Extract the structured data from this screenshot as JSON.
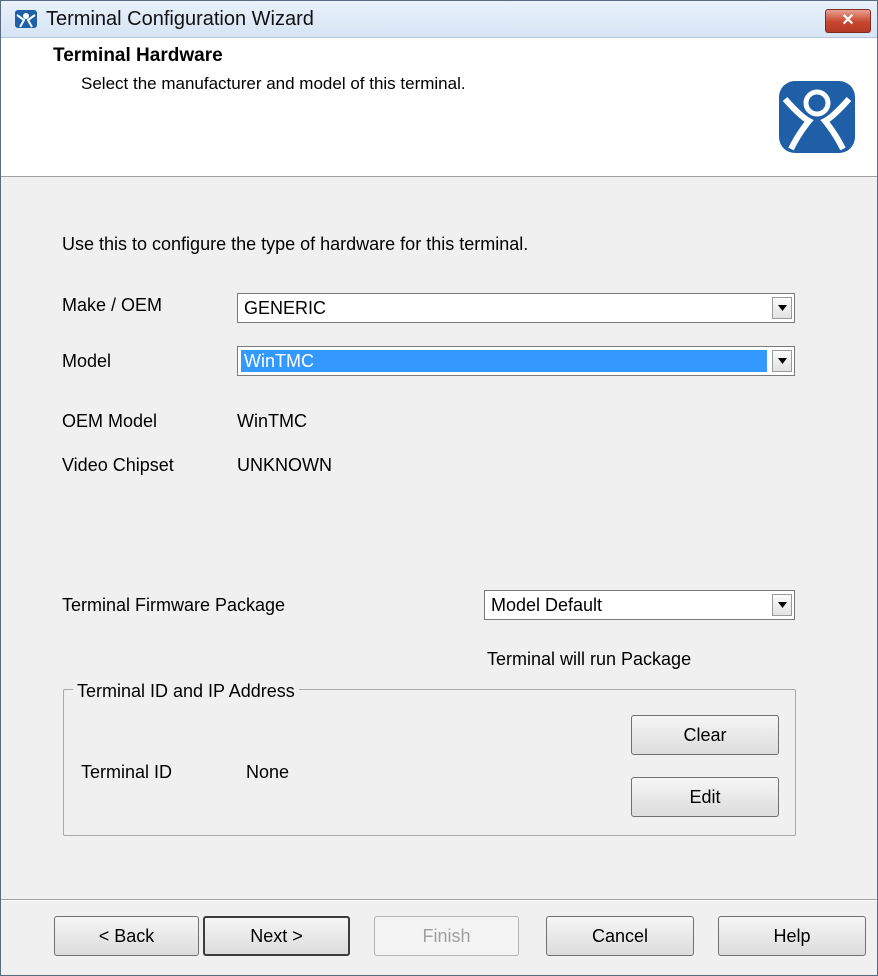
{
  "window": {
    "title": "Terminal Configuration Wizard",
    "close_label": "✕"
  },
  "header": {
    "title": "Terminal Hardware",
    "subtitle": "Select the manufacturer and model of this terminal."
  },
  "intro": "Use this to configure the type of hardware for this terminal.",
  "fields": {
    "make": {
      "label": "Make / OEM",
      "value": "GENERIC"
    },
    "model": {
      "label": "Model",
      "value": "WinTMC"
    },
    "oem_model": {
      "label": "OEM Model",
      "value": "WinTMC"
    },
    "video_chipset": {
      "label": "Video Chipset",
      "value": "UNKNOWN"
    }
  },
  "firmware": {
    "label": "Terminal Firmware Package",
    "value": "Model Default",
    "note": "Terminal will run Package"
  },
  "group": {
    "legend": "Terminal ID and IP Address",
    "terminal_id_label": "Terminal ID",
    "terminal_id_value": "None",
    "clear_label": "Clear",
    "edit_label": "Edit"
  },
  "footer": {
    "back_label": "< Back",
    "next_label": "Next >",
    "finish_label": "Finish",
    "cancel_label": "Cancel",
    "help_label": "Help"
  },
  "colors": {
    "selection": "#3399ff",
    "close": "#c7462f",
    "logo": "#1f5fa8"
  },
  "icons": {
    "app": "thinmanager-icon",
    "logo": "thinmanager-logo"
  }
}
